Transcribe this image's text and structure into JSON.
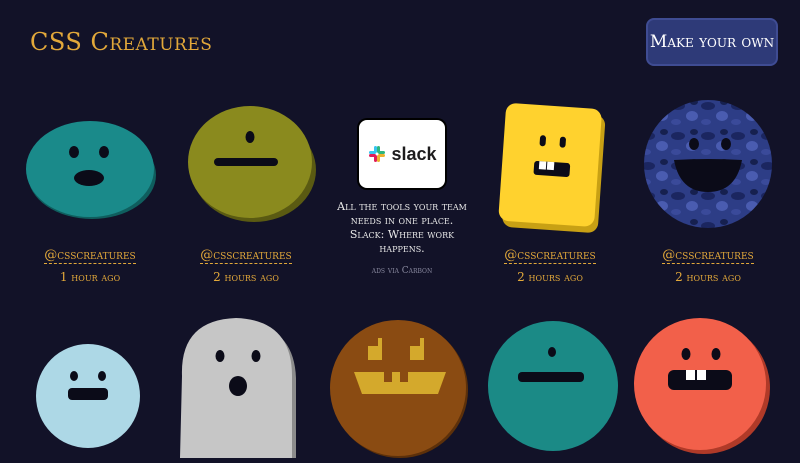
{
  "header": {
    "title": "CSS Creatures",
    "make_button": "Make your own"
  },
  "creatures_row1": [
    {
      "handle": "@csscreatures",
      "time": "1 hour ago",
      "color": "#1a8a8a"
    },
    {
      "handle": "@csscreatures",
      "time": "2 hours ago",
      "color": "#8a8a1e"
    },
    {
      "handle": "@csscreatures",
      "time": "2 hours ago",
      "color": "#ffd22e"
    },
    {
      "handle": "@csscreatures",
      "time": "2 hours ago",
      "color": "#2d3d86"
    }
  ],
  "creatures_row2": [
    {
      "color": "#add8e6"
    },
    {
      "color": "#c6c6c6"
    },
    {
      "color": "#8a4b12"
    },
    {
      "color": "#1b8a86"
    },
    {
      "color": "#f2604a"
    }
  ],
  "ad": {
    "brand": "slack",
    "text": "All the tools your team needs in one place. Slack: Where work happens.",
    "via": "ads via Carbon"
  }
}
